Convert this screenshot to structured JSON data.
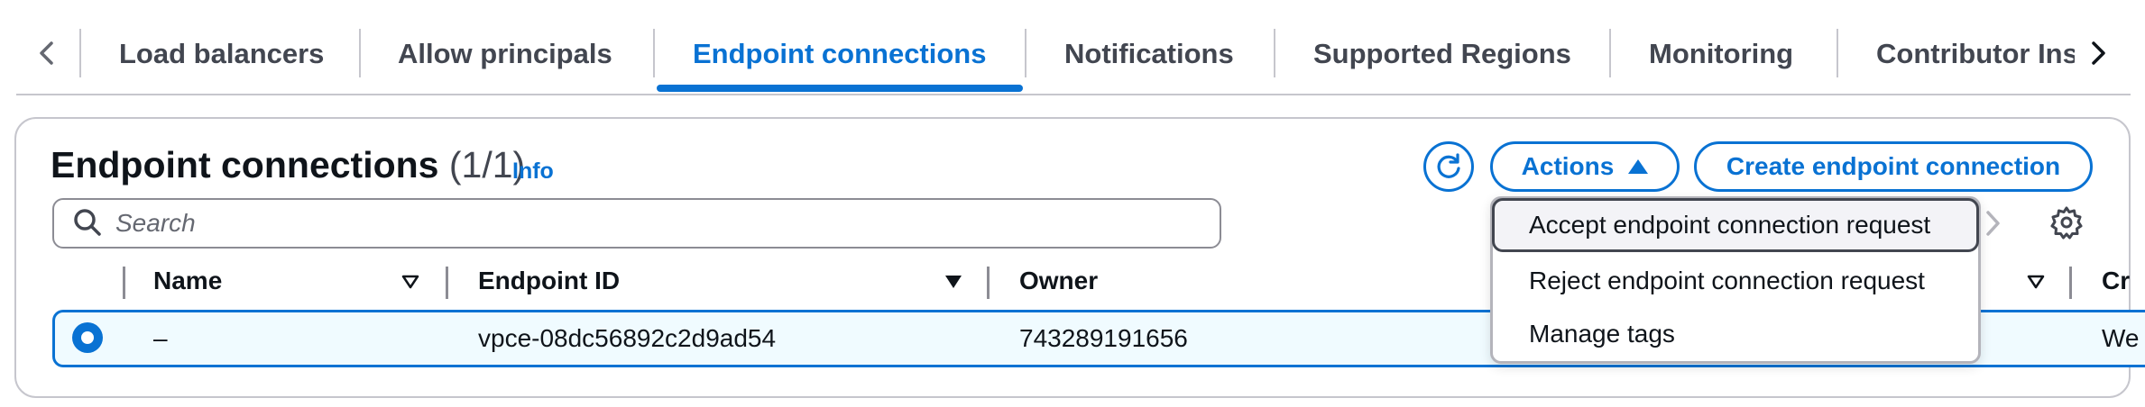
{
  "tabs": [
    {
      "label": "Load balancers"
    },
    {
      "label": "Allow principals"
    },
    {
      "label": "Endpoint connections"
    },
    {
      "label": "Notifications"
    },
    {
      "label": "Supported Regions"
    },
    {
      "label": "Monitoring"
    },
    {
      "label": "Contributor Insights"
    }
  ],
  "active_tab": "Endpoint connections",
  "header": {
    "title": "Endpoint connections",
    "count": "(1/1)",
    "info": "Info"
  },
  "toolbar": {
    "actions_label": "Actions",
    "create_label": "Create endpoint connection"
  },
  "search": {
    "placeholder": "Search",
    "value": ""
  },
  "table": {
    "columns": [
      "Name",
      "Endpoint ID",
      "Owner",
      "Cr"
    ],
    "rows": [
      {
        "name": "–",
        "endpoint_id": "vpce-08dc56892c2d9ad54",
        "owner": "743289191656",
        "created": "We",
        "selected": true
      }
    ]
  },
  "actions_menu": {
    "items": [
      {
        "label": "Accept endpoint connection request",
        "highlighted": true
      },
      {
        "label": "Reject endpoint connection request",
        "highlighted": false
      },
      {
        "label": "Manage tags",
        "highlighted": false
      }
    ]
  },
  "colors": {
    "accent": "#0972d3",
    "text": "#0f141a",
    "muted_text": "#424650",
    "selected_row_bg": "#f0fbff",
    "border": "#c6c6cd"
  },
  "icons": {
    "tabs_prev": "chevron-left-icon",
    "tabs_next": "chevron-right-icon",
    "refresh": "refresh-icon",
    "actions_caret": "caret-up-icon",
    "search": "search-icon",
    "pager_next": "chevron-right-icon",
    "settings": "gear-icon",
    "sort": "sort-caret-icon"
  }
}
